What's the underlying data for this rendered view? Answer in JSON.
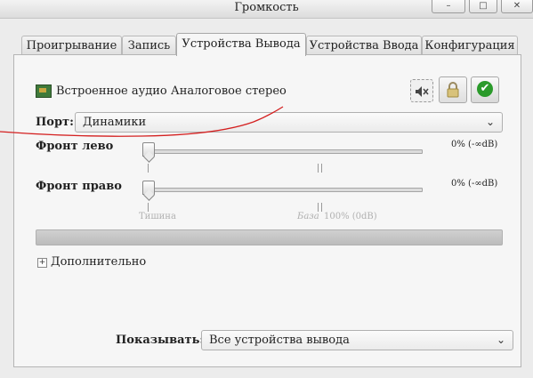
{
  "window": {
    "title": "Громкость",
    "buttons": {
      "minimize": "–",
      "maximize": "□",
      "close": "✕"
    }
  },
  "tabs": [
    {
      "label": "Проигрывание",
      "active": false
    },
    {
      "label": "Запись",
      "active": false
    },
    {
      "label": "Устройства Вывода",
      "active": true
    },
    {
      "label": "Устройства Ввода",
      "active": false
    },
    {
      "label": "Конфигурация",
      "active": false
    }
  ],
  "device": {
    "name": "Встроенное аудио Аналоговое стерео",
    "icons": {
      "mute": "speaker-mute-icon",
      "lock": "lock-icon",
      "default": "checkmark-icon"
    }
  },
  "port": {
    "label": "Порт:",
    "value": "Динамики"
  },
  "channels": [
    {
      "label": "Фронт лево",
      "value_text": "0% (-∞dB)",
      "level": 0
    },
    {
      "label": "Фронт право",
      "value_text": "0% (-∞dB)",
      "level": 0
    }
  ],
  "scale": {
    "silence": "Тишина",
    "base": "База",
    "full": "100% (0dB)"
  },
  "advanced": {
    "label": "Дополнительно",
    "expander": "+"
  },
  "show": {
    "label": "Показывать:",
    "value": "Все устройства вывода"
  },
  "colors": {
    "annotation": "#d42020",
    "default_check": "#2a9a2a"
  }
}
